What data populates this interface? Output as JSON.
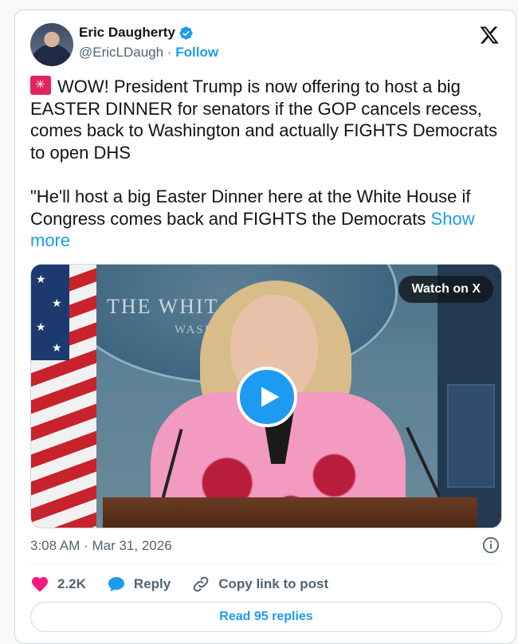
{
  "author": {
    "name": "Eric Daugherty",
    "handle": "@EricLDaugh",
    "separator": "·",
    "follow_label": "Follow"
  },
  "post": {
    "line1_emoji": "rotating-light-icon",
    "paragraph1": "WOW! President Trump is now offering to host a big EASTER DINNER for senators if the GOP cancels recess, comes back to Washington and actually FIGHTS Democrats to open DHS",
    "paragraph2": "\"He'll host a big Easter Dinner here at the White House if Congress comes back and FIGHTS the Democrats",
    "show_more_label": "Show more"
  },
  "media": {
    "watch_label": "Watch on X",
    "backdrop_text": "THE WHIT     USE",
    "backdrop_subtext": "WASH"
  },
  "meta": {
    "timestamp": "3:08 AM · Mar 31, 2026"
  },
  "actions": {
    "likes_count": "2.2K",
    "reply_label": "Reply",
    "copy_label": "Copy link to post"
  },
  "footer": {
    "read_replies_label": "Read 95 replies"
  },
  "colors": {
    "accent": "#1d9bf0",
    "like": "#f91880",
    "text_primary": "#0f1419",
    "text_secondary": "#536471"
  }
}
